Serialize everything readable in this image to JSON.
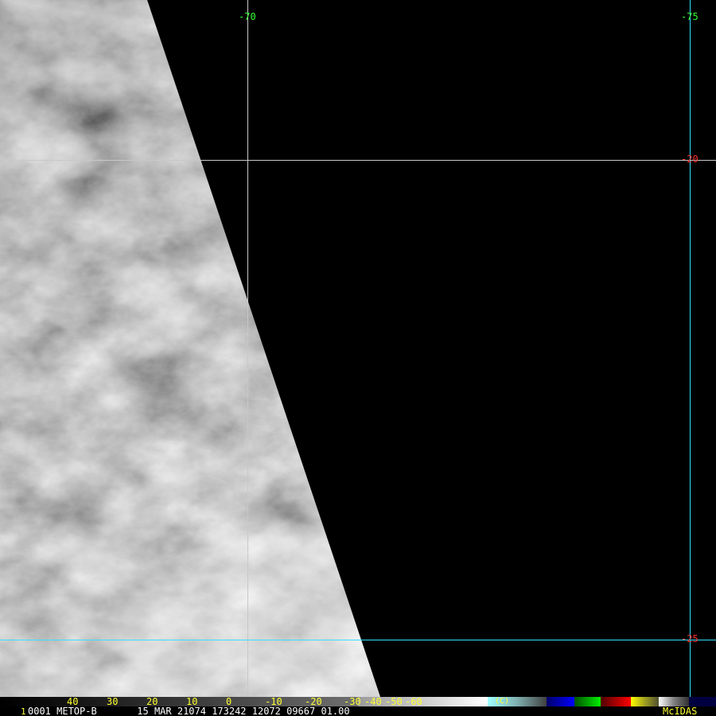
{
  "map": {
    "longitude_labels": [
      "-70",
      "-75"
    ],
    "latitude_labels": [
      "-20",
      "-25"
    ],
    "grid_colors": {
      "primary": "#c8c8c8",
      "highlight": "#33e0ff"
    },
    "label_colors": {
      "longitude": "#33ff33",
      "latitude": "#ff3030"
    }
  },
  "colorbar": {
    "tick_labels": [
      "40",
      "30",
      "20",
      "10",
      "0",
      "-10",
      "-20",
      "-30",
      "-40",
      "-50",
      "-60"
    ],
    "unit_label": "(C)",
    "segment_colors": [
      "#0000a0",
      "#00b000",
      "#c00000",
      "#e0e000",
      "#ffffff",
      "#000040"
    ]
  },
  "infobar": {
    "frame_number": "1",
    "text": "0001 METOP-B       15 MAR 21074 173242 12072 09667 01.00",
    "brand": "McIDAS"
  }
}
